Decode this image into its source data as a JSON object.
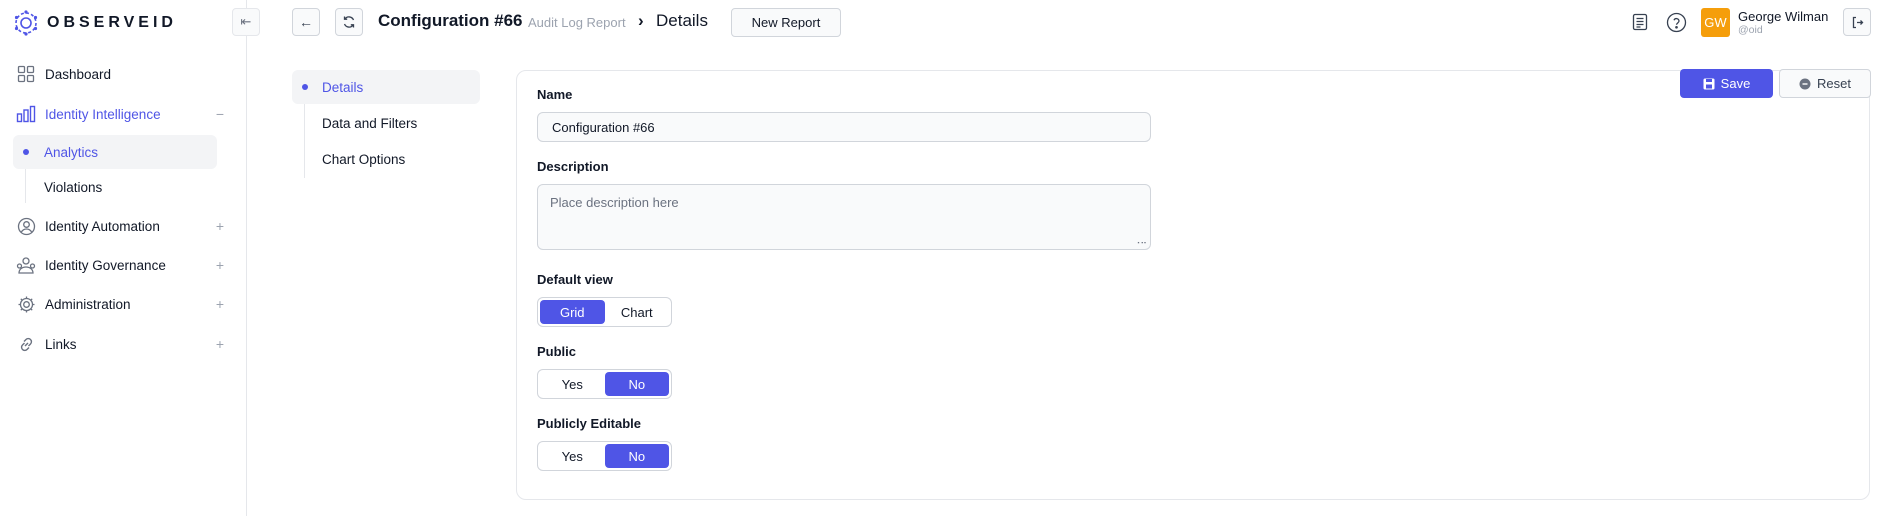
{
  "brand": {
    "name": "OBSERVEID"
  },
  "sidebar": {
    "items": [
      {
        "label": "Dashboard",
        "icon": "grid-icon"
      },
      {
        "label": "Identity Intelligence",
        "icon": "bar-chart-icon",
        "toggle": "−"
      },
      {
        "label": "Identity Automation",
        "icon": "user-circle-icon",
        "toggle": "+"
      },
      {
        "label": "Identity Governance",
        "icon": "governance-icon",
        "toggle": "+"
      },
      {
        "label": "Administration",
        "icon": "gear-icon",
        "toggle": "+"
      },
      {
        "label": "Links",
        "icon": "link-icon",
        "toggle": "+"
      }
    ],
    "subitems": [
      {
        "label": "Analytics"
      },
      {
        "label": "Violations"
      }
    ]
  },
  "header": {
    "title": "Configuration #66",
    "breadcrumb_parent": "Audit Log Report",
    "breadcrumb_sep": "›",
    "breadcrumb_current": "Details",
    "new_report_label": "New Report"
  },
  "user": {
    "initials": "GW",
    "name": "George Wilman",
    "handle": "@oid"
  },
  "sections": [
    {
      "label": "Details"
    },
    {
      "label": "Data and Filters"
    },
    {
      "label": "Chart Options"
    }
  ],
  "form": {
    "name_label": "Name",
    "name_value": "Configuration #66",
    "description_label": "Description",
    "description_placeholder": "Place description here",
    "default_view_label": "Default view",
    "default_view_options": [
      "Grid",
      "Chart"
    ],
    "default_view_selected": "Grid",
    "public_label": "Public",
    "public_options": [
      "Yes",
      "No"
    ],
    "public_selected": "No",
    "public_editable_label": "Publicly Editable",
    "public_editable_options": [
      "Yes",
      "No"
    ],
    "public_editable_selected": "No"
  },
  "actions": {
    "save_label": "Save",
    "reset_label": "Reset"
  },
  "colors": {
    "accent": "#4f55e6",
    "avatar": "#f59e0b"
  }
}
